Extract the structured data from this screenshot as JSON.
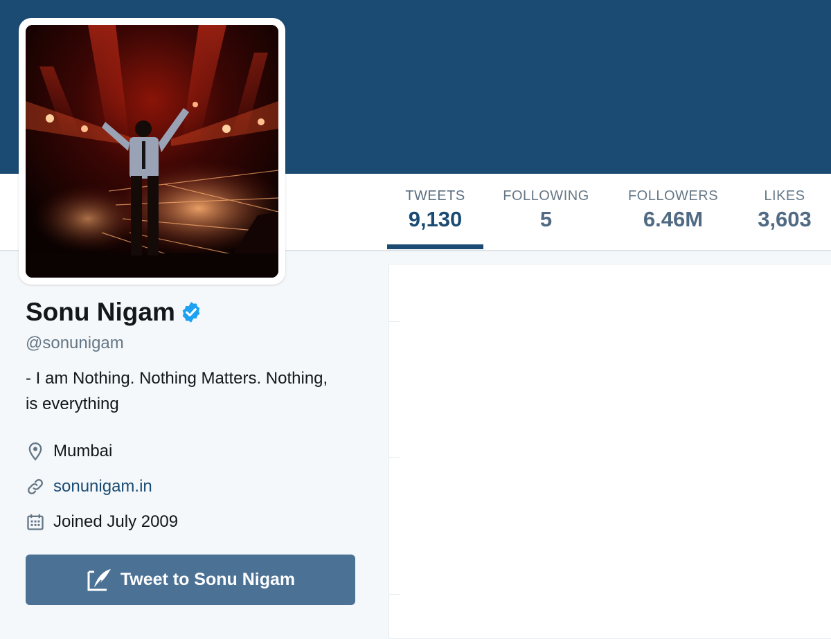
{
  "profile": {
    "name": "Sonu Nigam",
    "handle": "@sonunigam",
    "bio_line1": "- I am Nothing. Nothing Matters. Nothing,",
    "bio_line2": "is everything",
    "location": "Mumbai",
    "website": "sonunigam.in",
    "joined": "Joined July 2009",
    "verified": true
  },
  "stats": [
    {
      "label": "TWEETS",
      "value": "9,130",
      "active": true
    },
    {
      "label": "FOLLOWING",
      "value": "5",
      "active": false
    },
    {
      "label": "FOLLOWERS",
      "value": "6.46M",
      "active": false
    },
    {
      "label": "LIKES",
      "value": "3,603",
      "active": false
    }
  ],
  "actions": {
    "tweet_to_label": "Tweet to Sonu Nigam"
  },
  "icons": {
    "verified": "verified-badge-icon",
    "location": "location-pin-icon",
    "website": "link-icon",
    "joined": "calendar-icon",
    "tweet_to": "compose-tweet-icon"
  },
  "colors": {
    "banner": "#1b4b73",
    "accent": "#1b4b73",
    "verified": "#1da1f2",
    "button": "#4b7195",
    "background": "#f5f8fa"
  }
}
